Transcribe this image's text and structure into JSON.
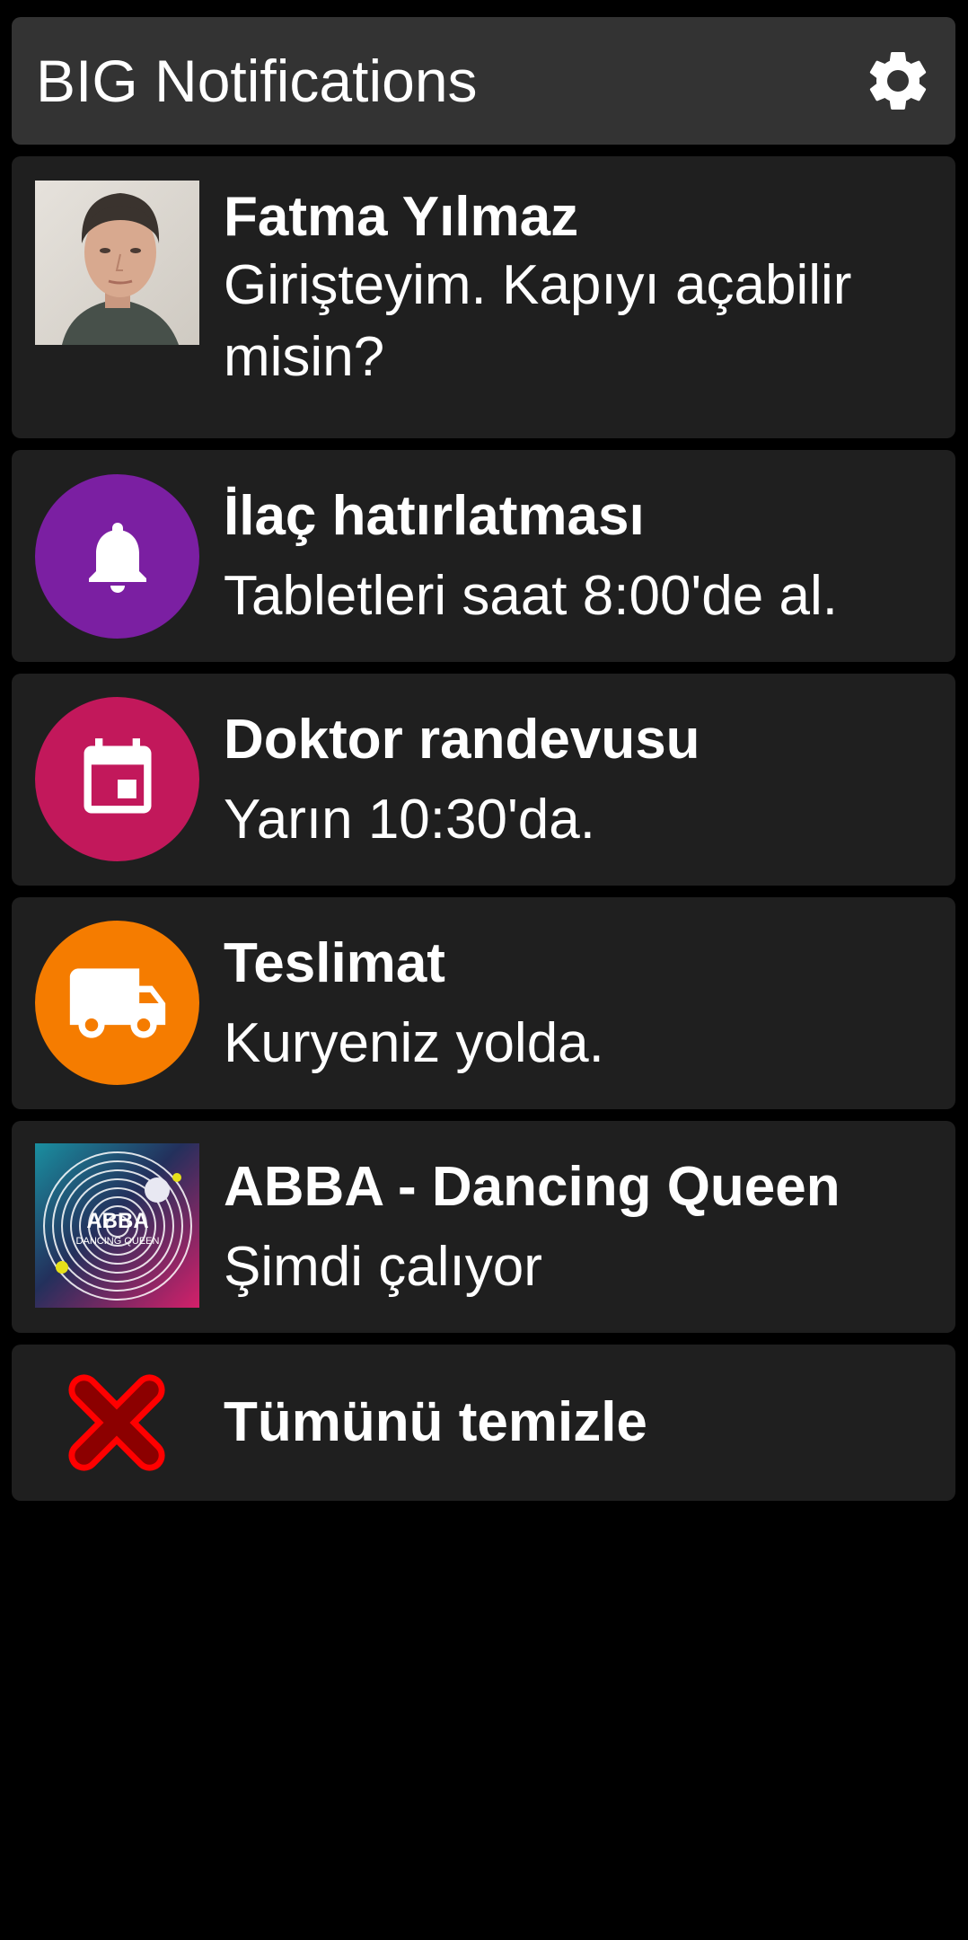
{
  "header": {
    "title": "BIG Notifications"
  },
  "notifications": [
    {
      "title": "Fatma Yılmaz",
      "body": "Girişteyim. Kapıyı açabilir misin?",
      "icon": "contact-photo"
    },
    {
      "title": "İlaç hatırlatması",
      "body": "Tabletleri saat 8:00'de al.",
      "icon": "bell-icon",
      "color": "#7b1fa2"
    },
    {
      "title": "Doktor randevusu",
      "body": "Yarın 10:30'da.",
      "icon": "calendar-icon",
      "color": "#c2185b"
    },
    {
      "title": "Teslimat",
      "body": "Kuryeniz yolda.",
      "icon": "truck-icon",
      "color": "#f57c00"
    },
    {
      "title": "ABBA - Dancing Queen",
      "body": "Şimdi çalıyor",
      "icon": "album-art",
      "album_art_text": [
        "ABBA",
        "DANCING QUEEN"
      ]
    }
  ],
  "clear_all": {
    "label": "Tümünü temizle",
    "icon": "close-icon",
    "color": "#d50000"
  }
}
